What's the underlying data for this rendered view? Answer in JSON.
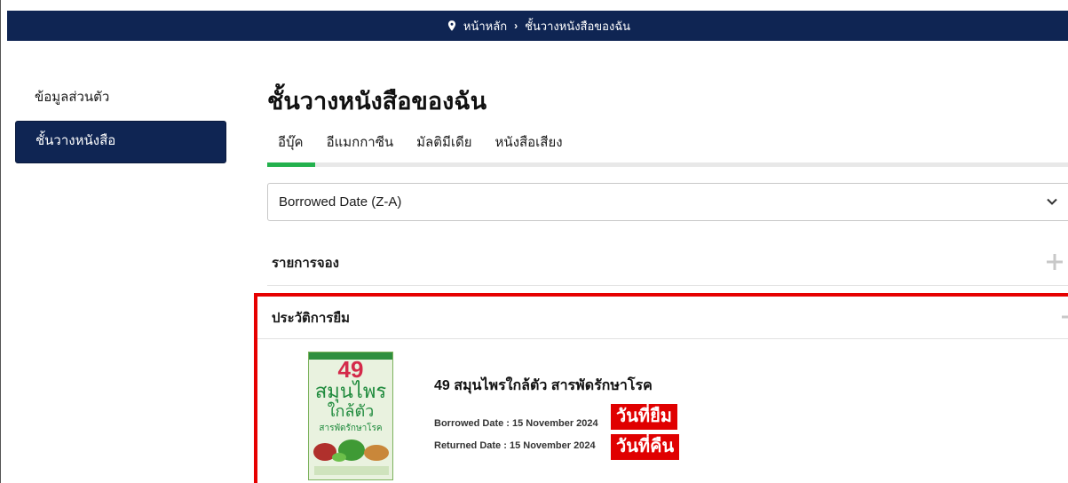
{
  "breadcrumb": {
    "home": "หน้าหลัก",
    "current": "ชั้นวางหนังสือของฉัน"
  },
  "sidebar": {
    "items": [
      {
        "label": "ข้อมูลส่วนตัว"
      },
      {
        "label": "ชั้นวางหนังสือ"
      }
    ]
  },
  "main": {
    "title": "ชั้นวางหนังสือของฉัน",
    "tabs": [
      {
        "label": "อีบุ๊ค"
      },
      {
        "label": "อีแมกกาซีน"
      },
      {
        "label": "มัลติมีเดีย"
      },
      {
        "label": "หนังสือเสียง"
      }
    ],
    "sort": {
      "value": "Borrowed Date (Z-A)"
    },
    "reserve_section": {
      "label": "รายการจอง"
    },
    "history_section": {
      "label": "ประวัติการยืม"
    }
  },
  "history_item": {
    "title": "49 สมุนไพรใกล้ตัว สารพัดรักษาโรค",
    "borrowed": "Borrowed Date : 15 November 2024",
    "returned": "Returned Date : 15 November 2024",
    "cover": {
      "number": "49",
      "line1": "สมุนไพร",
      "line2": "ใกล้ตัว",
      "line3": "สารพัดรักษาโรค"
    }
  },
  "annotations": {
    "borrow_label": "วันที่ยืม",
    "return_label": "วันที่คืน"
  },
  "colors": {
    "navy": "#0f2553",
    "tab_active": "#23b14d",
    "highlight": "#e60000"
  }
}
